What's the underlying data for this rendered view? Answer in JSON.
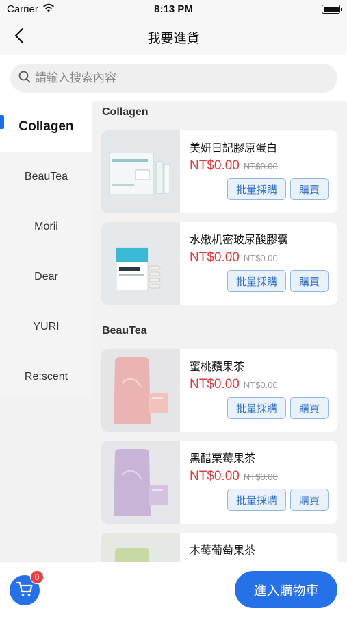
{
  "status_bar": {
    "carrier": "Carrier",
    "time": "8:13 PM"
  },
  "nav": {
    "title": "我要進貨"
  },
  "search": {
    "placeholder": "請輸入搜索內容"
  },
  "sidebar": {
    "items": [
      {
        "label": "Collagen",
        "active": true
      },
      {
        "label": "BeauTea",
        "active": false
      },
      {
        "label": "Morii",
        "active": false
      },
      {
        "label": "Dear",
        "active": false
      },
      {
        "label": "YURI",
        "active": false
      },
      {
        "label": "Re:scent",
        "active": false
      }
    ]
  },
  "sections": [
    {
      "title": "Collagen",
      "products": [
        {
          "name": "美妍日記膠原蛋白",
          "price": "NT$0.00",
          "old_price": "NT$0.00",
          "bulk_label": "批量採購",
          "buy_label": "購買"
        },
        {
          "name": "水嫩机密玻尿酸膠囊",
          "price": "NT$0.00",
          "old_price": "NT$0.00",
          "bulk_label": "批量採購",
          "buy_label": "購買"
        }
      ]
    },
    {
      "title": "BeauTea",
      "products": [
        {
          "name": "蜜桃蘋果茶",
          "price": "NT$0.00",
          "old_price": "NT$0.00",
          "bulk_label": "批量採購",
          "buy_label": "購買"
        },
        {
          "name": "黑醋栗莓果茶",
          "price": "NT$0.00",
          "old_price": "NT$0.00",
          "bulk_label": "批量採購",
          "buy_label": "購買"
        },
        {
          "name": "木莓葡萄果茶"
        }
      ]
    }
  ],
  "cart": {
    "badge": "0",
    "checkout_label": "進入購物車"
  },
  "colors": {
    "accent": "#2670e8",
    "price": "#e0393e",
    "badge": "#ee3b3b"
  },
  "icons": [
    "wifi-icon",
    "battery-icon",
    "back-arrow-icon",
    "search-icon",
    "cart-icon"
  ]
}
